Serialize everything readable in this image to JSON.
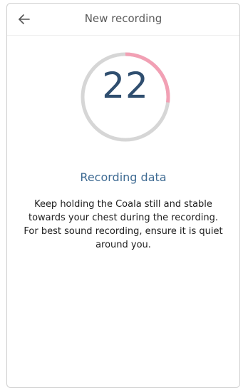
{
  "header": {
    "title": "New recording",
    "back_icon": "arrow-left-icon"
  },
  "timer": {
    "value": "22",
    "progress_fraction": 0.27,
    "track_color": "#d6d6d6",
    "progress_color": "#f2a0b4"
  },
  "status": {
    "text": "Recording data"
  },
  "instructions": {
    "text": "Keep holding the Coala still and stable towards your chest during the recording. For best sound recording, ensure it is quiet around you."
  }
}
